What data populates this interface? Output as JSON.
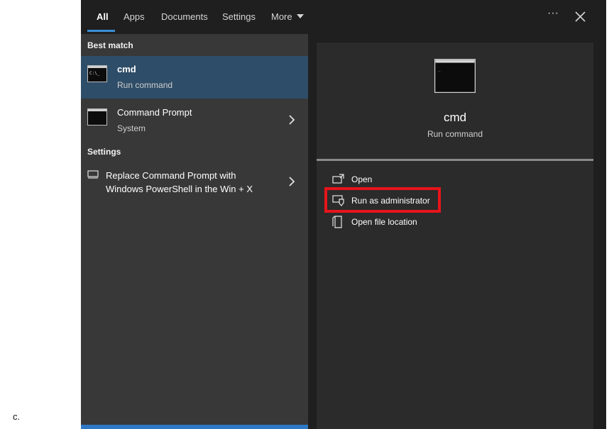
{
  "caption": "c.",
  "tabs": [
    {
      "label": "All"
    },
    {
      "label": "Apps"
    },
    {
      "label": "Documents"
    },
    {
      "label": "Settings"
    },
    {
      "label": "More"
    }
  ],
  "window_controls": {
    "more_options": "···"
  },
  "left": {
    "best_match_heading": "Best match",
    "best_match": {
      "title": "cmd",
      "subtitle": "Run command"
    },
    "other_result": {
      "title": "Command Prompt",
      "subtitle": "System"
    },
    "settings_heading": "Settings",
    "setting_item": {
      "line1": "Replace Command Prompt with",
      "line2": "Windows PowerShell in the Win + X"
    }
  },
  "detail": {
    "title": "cmd",
    "subtitle": "Run command",
    "actions": [
      {
        "label": "Open",
        "icon": "open-icon"
      },
      {
        "label": "Run as administrator",
        "icon": "shield-admin-icon"
      },
      {
        "label": "Open file location",
        "icon": "file-location-icon"
      }
    ]
  },
  "colors": {
    "accent": "#3b8fd6",
    "selected_row": "#2e4d68",
    "highlight": "#e8141b"
  }
}
